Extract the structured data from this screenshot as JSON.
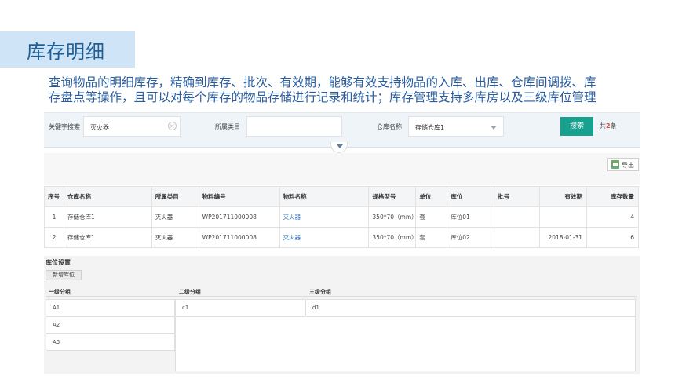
{
  "slide": {
    "title": "库存明细",
    "description_line1": "查询物品的明细库存，精确到库存、批次、有效期，能够有效支持物品的入库、出库、仓库间调拨、库",
    "description_line2": "存盘点等操作，且可以对每个库存的物品存储进行记录和统计；库存管理支持多库房以及三级库位管理"
  },
  "search": {
    "keyword_label": "关键字搜索",
    "keyword_value": "灭火器",
    "category_label": "所属类目",
    "category_value": "",
    "warehouse_label": "仓库名称",
    "warehouse_value": "存储仓库1",
    "search_button": "搜索",
    "total_prefix": "共",
    "total_count": "2",
    "total_suffix": "条"
  },
  "toolbar": {
    "export_label": "导出"
  },
  "inventory_table": {
    "columns": [
      "序号",
      "仓库名称",
      "所属类目",
      "物料编号",
      "物料名称",
      "规格型号",
      "单位",
      "库位",
      "批号",
      "有效期",
      "库存数量"
    ],
    "rows": [
      [
        "1",
        "存储仓库1",
        "灭火器",
        "WP201711000008",
        "灭火器",
        "350*70（mm）",
        "套",
        "库位01",
        "",
        "",
        "4"
      ],
      [
        "2",
        "存储仓库1",
        "灭火器",
        "WP201711000008",
        "灭火器",
        "350*70（mm）",
        "套",
        "库位02",
        "",
        "2018-01-31",
        "6"
      ]
    ]
  },
  "location_settings": {
    "title": "库位设置",
    "new_button": "新增库位",
    "headers": [
      "一级分组",
      "二级分组",
      "三级分组"
    ],
    "level1": [
      "A1",
      "A2",
      "A3"
    ],
    "level2": [
      "c1"
    ],
    "level3": [
      "d1"
    ]
  },
  "colors": {
    "accent": "#19a190",
    "title_bar": "#cfe4f6",
    "text_blue": "#2a5d9f",
    "link": "#2d6cc0",
    "count_red": "#e6483a"
  }
}
